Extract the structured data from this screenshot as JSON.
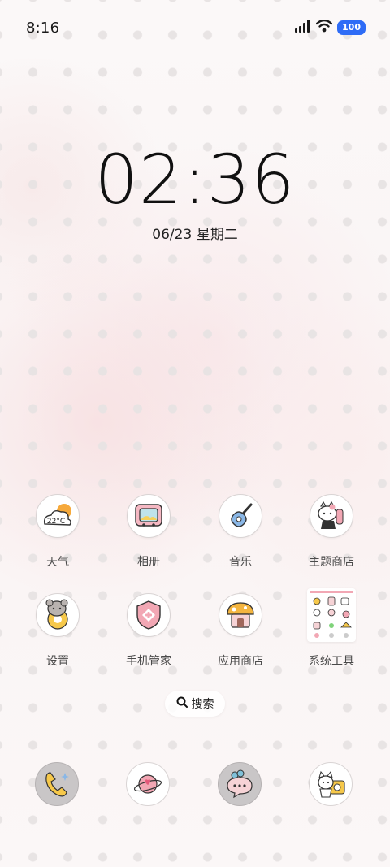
{
  "status_bar": {
    "time": "8:16",
    "battery": "100",
    "icons": [
      "signal-icon",
      "wifi-icon",
      "battery-icon"
    ]
  },
  "lock_clock": {
    "time": "02:36",
    "date": "06/23 星期二"
  },
  "apps_row1": [
    {
      "label": "天气",
      "icon": "weather-icon",
      "temp": "22°C"
    },
    {
      "label": "相册",
      "icon": "gallery-icon"
    },
    {
      "label": "音乐",
      "icon": "music-guitar-icon"
    },
    {
      "label": "主题商店",
      "icon": "theme-store-icon"
    }
  ],
  "apps_row2": [
    {
      "label": "设置",
      "icon": "settings-flower-icon"
    },
    {
      "label": "手机管家",
      "icon": "security-shield-icon"
    },
    {
      "label": "应用商店",
      "icon": "app-store-mushroom-icon"
    },
    {
      "label": "系统工具",
      "icon": "system-tools-folder-icon"
    }
  ],
  "search": {
    "label": "搜索",
    "icon": "search-icon"
  },
  "dock": [
    {
      "icon": "phone-icon"
    },
    {
      "icon": "browser-planet-icon"
    },
    {
      "icon": "messages-bubble-icon"
    },
    {
      "icon": "camera-cat-icon"
    }
  ],
  "colors": {
    "accent_blue": "#2e6cf6",
    "icon_pink": "#f2a7b4",
    "icon_yellow": "#f6c84a"
  }
}
